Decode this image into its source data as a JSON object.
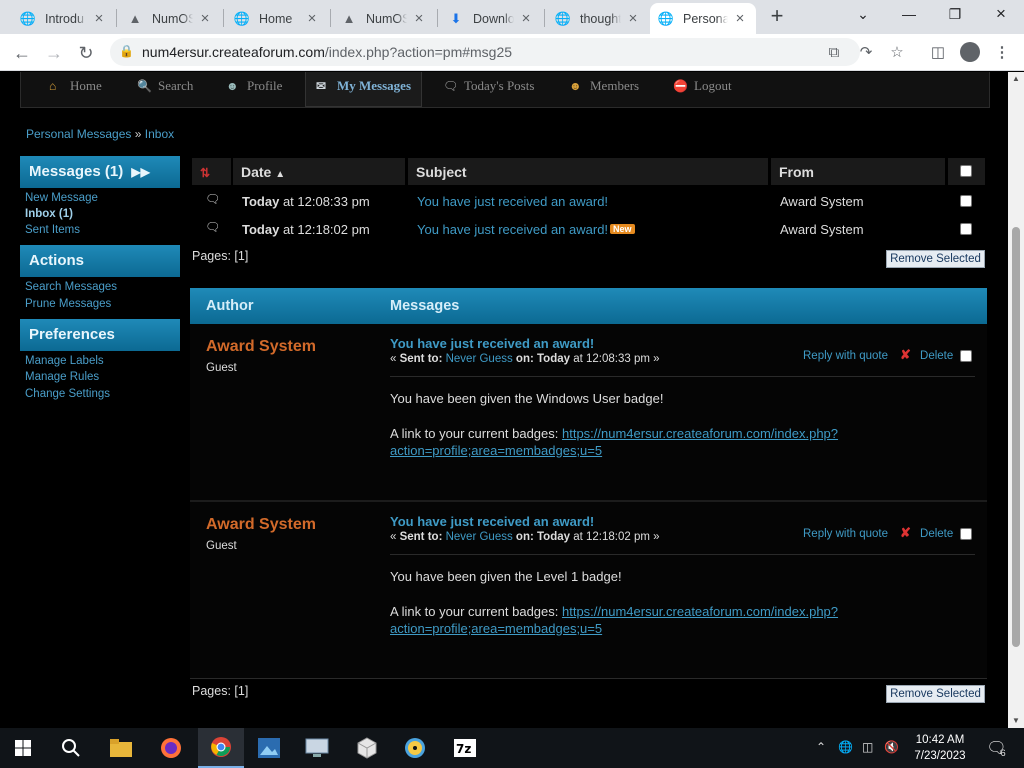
{
  "browser": {
    "tabs": [
      {
        "title": "Introdu",
        "icon": "globe-icon",
        "active": false
      },
      {
        "title": "NumOS",
        "icon": "forum-icon",
        "active": false
      },
      {
        "title": "Home",
        "icon": "globe-icon",
        "active": false
      },
      {
        "title": "NumOS",
        "icon": "forum-icon",
        "active": false
      },
      {
        "title": "Downlo",
        "icon": "download-icon",
        "active": false
      },
      {
        "title": "thought",
        "icon": "globe-icon",
        "active": false
      },
      {
        "title": "Persona",
        "icon": "globe-icon",
        "active": true
      }
    ],
    "url_host": "num4ersur.createaforum.com",
    "url_path": "/index.php?action=pm#msg25"
  },
  "forum": {
    "menu": [
      {
        "label": "Home",
        "icon": "home-icon"
      },
      {
        "label": "Search",
        "icon": "search-icon"
      },
      {
        "label": "Profile",
        "icon": "profile-icon"
      },
      {
        "label": "My Messages",
        "icon": "envelope-icon",
        "active": true
      },
      {
        "label": "Today's Posts",
        "icon": "posts-icon"
      },
      {
        "label": "Members",
        "icon": "members-icon"
      },
      {
        "label": "Logout",
        "icon": "logout-icon"
      }
    ],
    "breadcrumb": {
      "link": "Personal Messages",
      "sep": "»",
      "current": "Inbox"
    },
    "sidebar": {
      "messages_title": "Messages (1)",
      "messages_links": [
        "New Message",
        "Inbox (1)",
        "Sent Items"
      ],
      "actions_title": "Actions",
      "actions_links": [
        "Search Messages",
        "Prune Messages"
      ],
      "preferences_title": "Preferences",
      "preferences_links": [
        "Manage Labels",
        "Manage Rules",
        "Change Settings"
      ]
    },
    "list": {
      "columns": {
        "date": "Date",
        "subject": "Subject",
        "from": "From"
      },
      "rows": [
        {
          "date_bold": "Today",
          "date_rest": " at 12:08:33 pm",
          "subject": "You have just received an award!",
          "new": false,
          "from": "Award System"
        },
        {
          "date_bold": "Today",
          "date_rest": " at 12:18:02 pm",
          "subject": "You have just received an award!",
          "new": true,
          "new_label": "New",
          "from": "Award System"
        }
      ],
      "pages_label": "Pages: [1]",
      "remove_label": "Remove Selected"
    },
    "thread": {
      "author_col": "Author",
      "messages_col": "Messages",
      "posts": [
        {
          "author": "Award System",
          "role": "Guest",
          "subject": "You have just received an award!",
          "sent_prefix": "« ",
          "sent_to_label": "Sent to:",
          "sent_to": "Never Guess",
          "on_label": "on:",
          "on_bold": "Today",
          "on_rest": " at 12:08:33 pm »",
          "reply": "Reply with quote",
          "delete": "Delete",
          "body_line": "You have been given the Windows User badge!",
          "link_intro": "A link to your current badges: ",
          "link_text": "https://num4ersur.createaforum.com/index.php?action=profile;area=membadges;u=5"
        },
        {
          "author": "Award System",
          "role": "Guest",
          "subject": "You have just received an award!",
          "sent_prefix": "« ",
          "sent_to_label": "Sent to:",
          "sent_to": "Never Guess",
          "on_label": "on:",
          "on_bold": "Today",
          "on_rest": " at 12:18:02 pm »",
          "reply": "Reply with quote",
          "delete": "Delete",
          "body_line": "You have been given the Level 1 badge!",
          "link_intro": "A link to your current badges: ",
          "link_text": "https://num4ersur.createaforum.com/index.php?action=profile;area=membadges;u=5"
        }
      ],
      "pages_label": "Pages: [1]",
      "remove_label": "Remove Selected"
    }
  },
  "taskbar": {
    "time": "10:42 AM",
    "date": "7/23/2023",
    "notification_count": "6"
  }
}
